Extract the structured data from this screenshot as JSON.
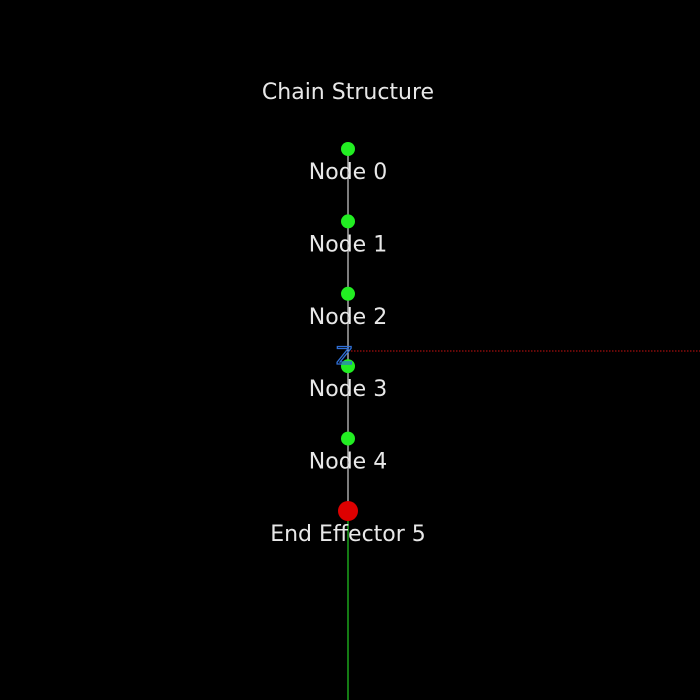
{
  "title": "Chain Structure",
  "colors": {
    "background": "#000000",
    "node": "#22ee22",
    "end_effector": "#dd0000",
    "link": "#d0d0d0",
    "text": "#e8e8e8",
    "axis_x": "#cc1111",
    "axis_y": "#22cc22",
    "axis_z": "#2f6fd6"
  },
  "axis_z_label": "Z",
  "nodes": [
    {
      "label": "Node 0",
      "type": "joint"
    },
    {
      "label": "Node 1",
      "type": "joint"
    },
    {
      "label": "Node 2",
      "type": "joint"
    },
    {
      "label": "Node 3",
      "type": "joint"
    },
    {
      "label": "Node 4",
      "type": "joint"
    },
    {
      "label": "End Effector 5",
      "type": "end-effector"
    }
  ]
}
